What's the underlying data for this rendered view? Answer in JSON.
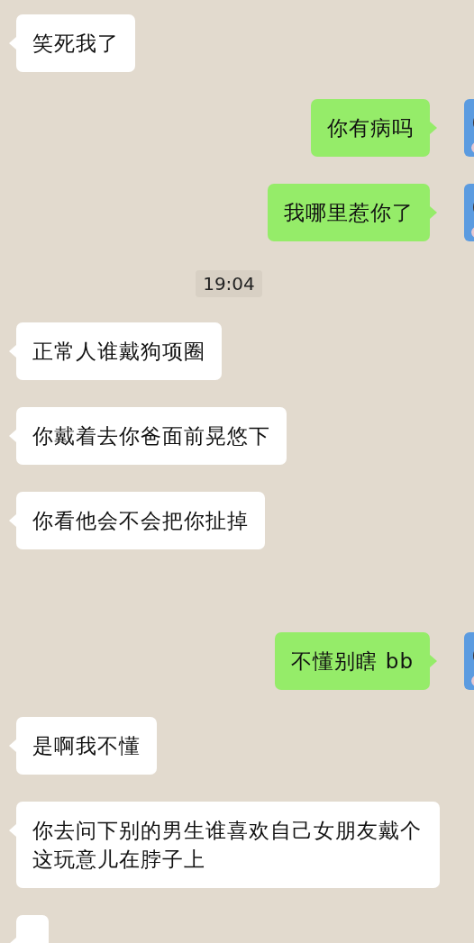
{
  "messages": [
    {
      "kind": "received",
      "text": "笑死我了"
    },
    {
      "kind": "sent",
      "text": "你有病吗"
    },
    {
      "kind": "sent",
      "text": "我哪里惹你了"
    },
    {
      "kind": "time",
      "text": "19:04"
    },
    {
      "kind": "received",
      "text": "正常人谁戴狗项圈"
    },
    {
      "kind": "received",
      "text": "你戴着去你爸面前晃悠下"
    },
    {
      "kind": "received",
      "text": "你看他会不会把你扯掉"
    },
    {
      "kind": "sent",
      "text": "不懂别瞎 bb"
    },
    {
      "kind": "received",
      "text": "是啊我不懂"
    },
    {
      "kind": "received",
      "text": "你去问下别的男生谁喜欢自己女朋友戴个这玩意儿在脖子上"
    },
    {
      "kind": "received"
    }
  ]
}
